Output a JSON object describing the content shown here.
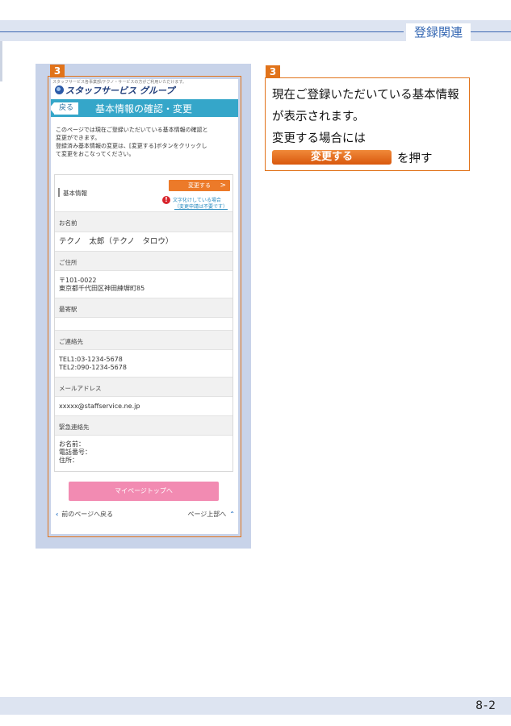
{
  "header": {
    "section_title": "登録関連"
  },
  "footer": {
    "page_number": "8-2"
  },
  "step_badge": "3",
  "phone": {
    "top_small_text": "スタッフサービス各事業部/テクノ・サービスの方がご利用いただけます。",
    "logo_text": "スタッフサービス グループ",
    "back_label": "戻る",
    "page_title": "基本情報の確認・変更",
    "description": [
      "このページでは現在ご登録いただいている基本情報の確認と",
      "変更ができます。",
      "登録済み基本情報の変更は、[変更する]ボタンをクリックし",
      "て変更をおこなってください。"
    ],
    "kihon_label": "基本情報",
    "change_button": "変更する",
    "change_chevron": ">",
    "warning_mark": "!",
    "warning_line1": "文字化けしている場合",
    "warning_line2": "（変更申請は不要です）",
    "fields": [
      {
        "label": "お名前",
        "value": [
          "テクノ　太郎（テクノ　タロウ）"
        ]
      },
      {
        "label": "ご住所",
        "value": [
          "〒101-0022",
          "東京都千代田区神田練塀町85"
        ]
      },
      {
        "label": "最寄駅",
        "value": [
          ""
        ]
      },
      {
        "label": "ご連絡先",
        "value": [
          "TEL1:03-1234-5678",
          "TEL2:090-1234-5678"
        ]
      },
      {
        "label": "メールアドレス",
        "value": [
          "xxxxx@staffservice.ne.jp"
        ]
      },
      {
        "label": "緊急連絡先",
        "value": [
          "お名前：",
          "電話番号：",
          "住所："
        ]
      }
    ],
    "mypage_button": "マイページトップへ",
    "prev_chevron": "‹",
    "prev_link": "前のページへ戻る",
    "top_link": "ページ上部へ",
    "top_chevron": "⌃"
  },
  "explanation": {
    "badge": "3",
    "line1": "現在ご登録いただいている基本情報",
    "line2": "が表示されます。",
    "line3": "変更する場合には",
    "button": "変更する",
    "push": "を押す"
  },
  "colors": {
    "accent_orange": "#e1731a",
    "header_blue": "#3467b3",
    "title_bar": "#35a6c9",
    "pink_button": "#f28bb2"
  }
}
